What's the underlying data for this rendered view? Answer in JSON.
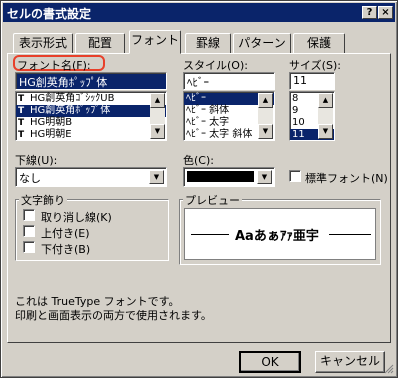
{
  "window": {
    "title": "セルの書式設定"
  },
  "titlebar": {
    "help": "?",
    "close": "×"
  },
  "tabs": [
    {
      "label": "表示形式",
      "active": false
    },
    {
      "label": "配置",
      "active": false
    },
    {
      "label": "フォント",
      "active": true
    },
    {
      "label": "罫線",
      "active": false
    },
    {
      "label": "パターン",
      "active": false
    },
    {
      "label": "保護",
      "active": false
    }
  ],
  "font": {
    "label": "フォント名(F):",
    "value": "HG創英角ﾎﾟｯﾌﾟ体",
    "items": [
      {
        "icon": "T",
        "label": "HG創英角ｺﾞｼｯｸUB",
        "selected": false
      },
      {
        "icon": "T",
        "label": "HG創英角ﾎﾟｯﾌﾟ体",
        "selected": true
      },
      {
        "icon": "T",
        "label": "HG明朝B",
        "selected": false
      },
      {
        "icon": "T",
        "label": "HG明朝E",
        "selected": false
      }
    ]
  },
  "style": {
    "label": "スタイル(O):",
    "value": "ﾍﾋﾞｰ",
    "items": [
      {
        "label": "ﾍﾋﾞｰ",
        "selected": true
      },
      {
        "label": "ﾍﾋﾞｰ 斜体",
        "selected": false
      },
      {
        "label": "ﾍﾋﾞｰ 太字",
        "selected": false
      },
      {
        "label": "ﾍﾋﾞｰ 太字 斜体",
        "selected": false
      }
    ]
  },
  "size": {
    "label": "サイズ(S):",
    "value": "11",
    "items": [
      {
        "label": "8",
        "selected": false
      },
      {
        "label": "9",
        "selected": false
      },
      {
        "label": "10",
        "selected": false
      },
      {
        "label": "11",
        "selected": true
      }
    ]
  },
  "underline": {
    "label": "下線(U):",
    "value": "なし"
  },
  "color": {
    "label": "色(C):",
    "swatch": "#000000"
  },
  "normal_font": {
    "label": "標準フォント(N)"
  },
  "effects": {
    "title": "文字飾り",
    "strikethrough": "取り消し線(K)",
    "superscript": "上付き(E)",
    "subscript": "下付き(B)"
  },
  "preview": {
    "title": "プレビュー",
    "sample": "Aaあぁｱｧ亜宇"
  },
  "info": {
    "line1": "これは TrueType フォントです。",
    "line2": "印刷と画面表示の両方で使用されます。"
  },
  "buttons": {
    "ok": "OK",
    "cancel": "キャンセル"
  },
  "accent": {
    "selection": "#0a246a",
    "highlight_ring": "#e8402a"
  }
}
